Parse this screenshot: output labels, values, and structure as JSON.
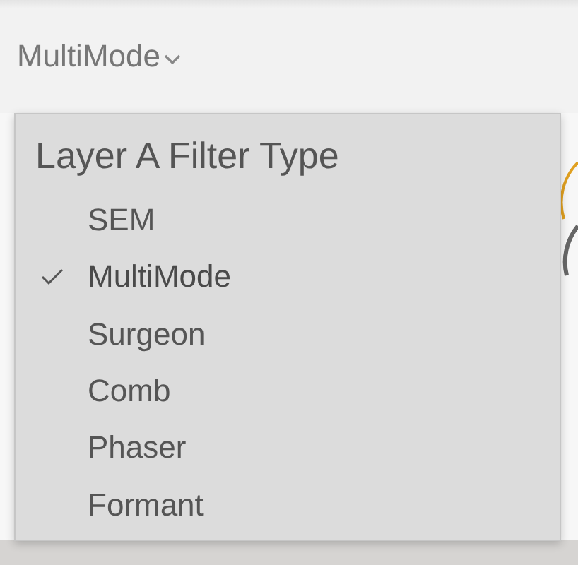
{
  "selector": {
    "value": "MultiMode"
  },
  "menu": {
    "title": "Layer A Filter Type",
    "items": [
      {
        "label": "SEM",
        "selected": false
      },
      {
        "label": "MultiMode",
        "selected": true
      },
      {
        "label": "Surgeon",
        "selected": false
      },
      {
        "label": "Comb",
        "selected": false
      },
      {
        "label": "Phaser",
        "selected": false
      },
      {
        "label": "Formant",
        "selected": false
      }
    ]
  }
}
